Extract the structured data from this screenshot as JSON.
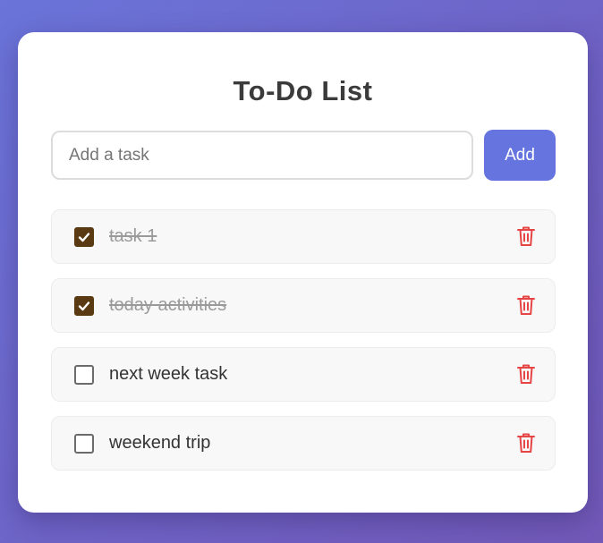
{
  "app": {
    "title": "To-Do List"
  },
  "add_form": {
    "placeholder": "Add a task",
    "value": "",
    "button_label": "Add"
  },
  "tasks": [
    {
      "text": "task 1",
      "completed": true
    },
    {
      "text": "today activities",
      "completed": true
    },
    {
      "text": "next week task",
      "completed": false
    },
    {
      "text": "weekend trip",
      "completed": false
    }
  ],
  "colors": {
    "background_start": "#6a74d9",
    "background_end": "#7259b8",
    "accent": "#6674e0",
    "checkbox_checked": "#5a3a12",
    "delete_icon": "#e64545"
  },
  "icons": {
    "checkbox": "check-icon",
    "delete": "trash-icon"
  }
}
